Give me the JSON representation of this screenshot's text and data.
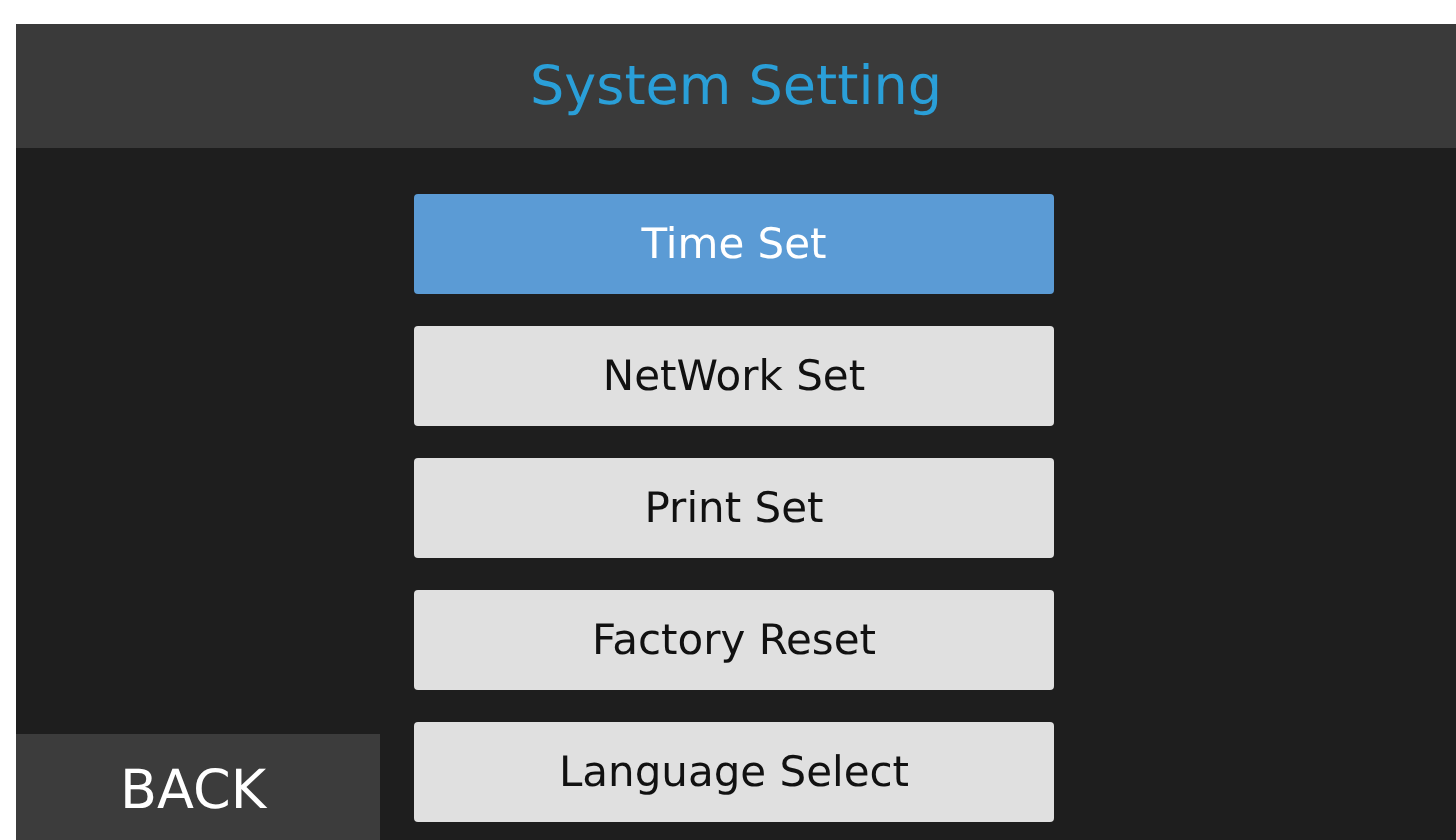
{
  "header": {
    "title": "System Setting"
  },
  "menu": [
    {
      "label": "Time Set",
      "selected": true
    },
    {
      "label": "NetWork Set",
      "selected": false
    },
    {
      "label": "Print Set",
      "selected": false
    },
    {
      "label": "Factory Reset",
      "selected": false
    },
    {
      "label": "Language Select",
      "selected": false
    }
  ],
  "back_button": {
    "label": "BACK"
  }
}
